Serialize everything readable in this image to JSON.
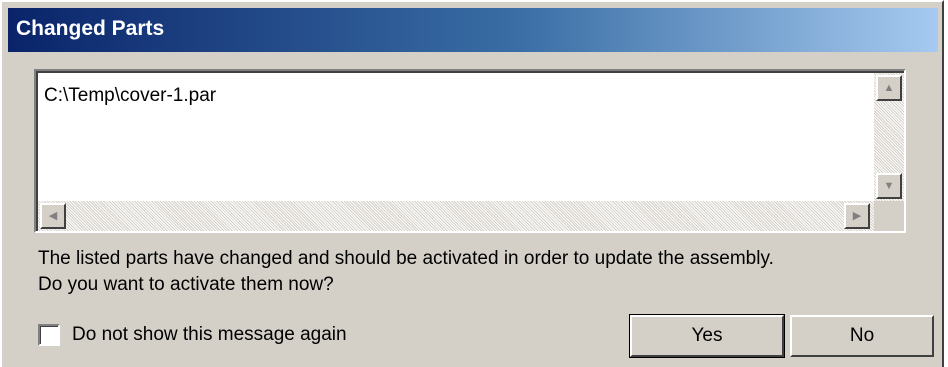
{
  "window": {
    "title": "Changed Parts"
  },
  "list": {
    "items": [
      "C:\\Temp\\cover-1.par"
    ]
  },
  "icons": {
    "scroll_up": "scroll-up-arrow-icon",
    "scroll_down": "scroll-down-arrow-icon",
    "scroll_left": "scroll-left-arrow-icon",
    "scroll_right": "scroll-right-arrow-icon"
  },
  "message": {
    "line1": "The listed parts have changed and should be activated in order to update the assembly.",
    "line2": "Do you want to activate them now?"
  },
  "checkbox": {
    "label": "Do not show this message again",
    "checked": false
  },
  "buttons": {
    "yes_label": "Yes",
    "no_label": "No"
  },
  "colors": {
    "title_gradient_start": "#0a246a",
    "title_gradient_end": "#a6caf0",
    "dialog_background": "#d4d0c8"
  }
}
